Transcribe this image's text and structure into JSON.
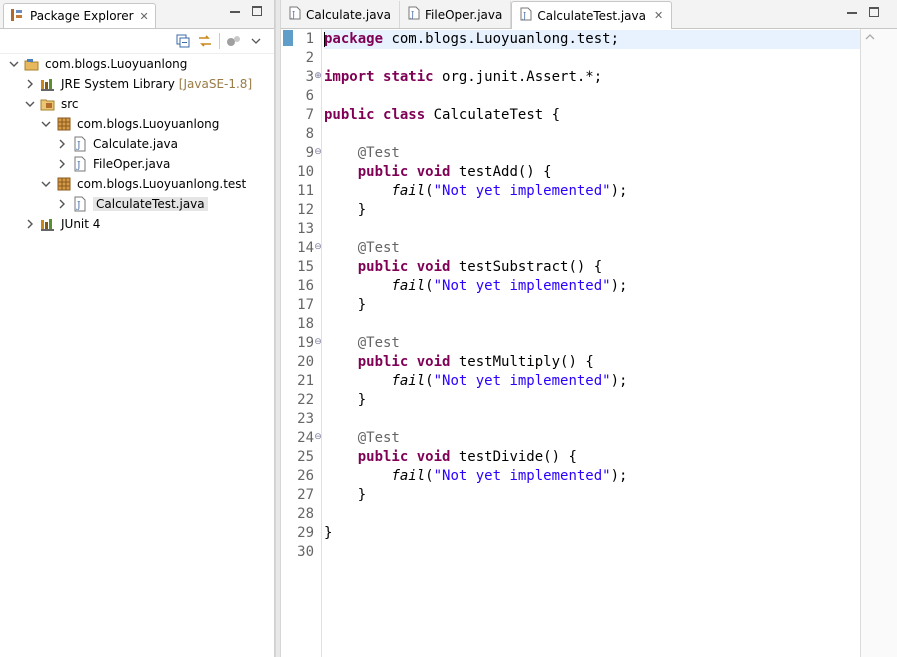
{
  "explorer": {
    "title": "Package Explorer",
    "tree": [
      {
        "label": "com.blogs.Luoyuanlong",
        "level": 0,
        "expanded": true,
        "icon": "project-icon"
      },
      {
        "label": "JRE System Library",
        "suffix": "[JavaSE-1.8]",
        "level": 1,
        "expanded": false,
        "icon": "library-icon"
      },
      {
        "label": "src",
        "level": 1,
        "expanded": true,
        "icon": "source-folder-icon"
      },
      {
        "label": "com.blogs.Luoyuanlong",
        "level": 2,
        "expanded": true,
        "icon": "package-icon"
      },
      {
        "label": "Calculate.java",
        "level": 3,
        "expanded": false,
        "icon": "java-file-icon"
      },
      {
        "label": "FileOper.java",
        "level": 3,
        "expanded": false,
        "icon": "java-file-icon"
      },
      {
        "label": "com.blogs.Luoyuanlong.test",
        "level": 2,
        "expanded": true,
        "icon": "package-icon"
      },
      {
        "label": "CalculateTest.java",
        "level": 3,
        "expanded": false,
        "icon": "java-file-icon",
        "selected": true
      },
      {
        "label": "JUnit 4",
        "level": 1,
        "expanded": false,
        "icon": "library-icon"
      }
    ]
  },
  "editor": {
    "tabs": [
      {
        "label": "Calculate.java",
        "active": false
      },
      {
        "label": "FileOper.java",
        "active": false
      },
      {
        "label": "CalculateTest.java",
        "active": true
      }
    ],
    "lines": [
      {
        "n": "1",
        "tokens": [
          [
            "kw",
            "package"
          ],
          [
            "t",
            " com.blogs.Luoyuanlong.test;"
          ]
        ]
      },
      {
        "n": "2",
        "tokens": []
      },
      {
        "n": "3",
        "tokens": [
          [
            "kw",
            "import"
          ],
          [
            "t",
            " "
          ],
          [
            "kw",
            "static"
          ],
          [
            "t",
            " org.junit.Assert.*;"
          ]
        ],
        "fold": "plus"
      },
      {
        "n": "6",
        "tokens": []
      },
      {
        "n": "7",
        "tokens": [
          [
            "kw",
            "public"
          ],
          [
            "t",
            " "
          ],
          [
            "kw",
            "class"
          ],
          [
            "t",
            " CalculateTest {"
          ]
        ]
      },
      {
        "n": "8",
        "tokens": []
      },
      {
        "n": "9",
        "tokens": [
          [
            "t",
            "    "
          ],
          [
            "an",
            "@Test"
          ]
        ],
        "fold": "minus"
      },
      {
        "n": "10",
        "tokens": [
          [
            "t",
            "    "
          ],
          [
            "kw",
            "public"
          ],
          [
            "t",
            " "
          ],
          [
            "kw",
            "void"
          ],
          [
            "t",
            " testAdd() {"
          ]
        ]
      },
      {
        "n": "11",
        "tokens": [
          [
            "t",
            "        "
          ],
          [
            "it",
            "fail"
          ],
          [
            "t",
            "("
          ],
          [
            "str",
            "\"Not yet implemented\""
          ],
          [
            "t",
            ");"
          ]
        ]
      },
      {
        "n": "12",
        "tokens": [
          [
            "t",
            "    }"
          ]
        ]
      },
      {
        "n": "13",
        "tokens": []
      },
      {
        "n": "14",
        "tokens": [
          [
            "t",
            "    "
          ],
          [
            "an",
            "@Test"
          ]
        ],
        "fold": "minus"
      },
      {
        "n": "15",
        "tokens": [
          [
            "t",
            "    "
          ],
          [
            "kw",
            "public"
          ],
          [
            "t",
            " "
          ],
          [
            "kw",
            "void"
          ],
          [
            "t",
            " testSubstract() {"
          ]
        ]
      },
      {
        "n": "16",
        "tokens": [
          [
            "t",
            "        "
          ],
          [
            "it",
            "fail"
          ],
          [
            "t",
            "("
          ],
          [
            "str",
            "\"Not yet implemented\""
          ],
          [
            "t",
            ");"
          ]
        ]
      },
      {
        "n": "17",
        "tokens": [
          [
            "t",
            "    }"
          ]
        ]
      },
      {
        "n": "18",
        "tokens": []
      },
      {
        "n": "19",
        "tokens": [
          [
            "t",
            "    "
          ],
          [
            "an",
            "@Test"
          ]
        ],
        "fold": "minus"
      },
      {
        "n": "20",
        "tokens": [
          [
            "t",
            "    "
          ],
          [
            "kw",
            "public"
          ],
          [
            "t",
            " "
          ],
          [
            "kw",
            "void"
          ],
          [
            "t",
            " testMultiply() {"
          ]
        ]
      },
      {
        "n": "21",
        "tokens": [
          [
            "t",
            "        "
          ],
          [
            "it",
            "fail"
          ],
          [
            "t",
            "("
          ],
          [
            "str",
            "\"Not yet implemented\""
          ],
          [
            "t",
            ");"
          ]
        ]
      },
      {
        "n": "22",
        "tokens": [
          [
            "t",
            "    }"
          ]
        ]
      },
      {
        "n": "23",
        "tokens": []
      },
      {
        "n": "24",
        "tokens": [
          [
            "t",
            "    "
          ],
          [
            "an",
            "@Test"
          ]
        ],
        "fold": "minus"
      },
      {
        "n": "25",
        "tokens": [
          [
            "t",
            "    "
          ],
          [
            "kw",
            "public"
          ],
          [
            "t",
            " "
          ],
          [
            "kw",
            "void"
          ],
          [
            "t",
            " testDivide() {"
          ]
        ]
      },
      {
        "n": "26",
        "tokens": [
          [
            "t",
            "        "
          ],
          [
            "it",
            "fail"
          ],
          [
            "t",
            "("
          ],
          [
            "str",
            "\"Not yet implemented\""
          ],
          [
            "t",
            ");"
          ]
        ]
      },
      {
        "n": "27",
        "tokens": [
          [
            "t",
            "    }"
          ]
        ]
      },
      {
        "n": "28",
        "tokens": []
      },
      {
        "n": "29",
        "tokens": [
          [
            "t",
            "}"
          ]
        ]
      },
      {
        "n": "30",
        "tokens": []
      }
    ]
  },
  "colors": {
    "keyword": "#7f0055",
    "string": "#2a00ff",
    "annotation": "#646464",
    "current_line": "#e8f2fe"
  }
}
